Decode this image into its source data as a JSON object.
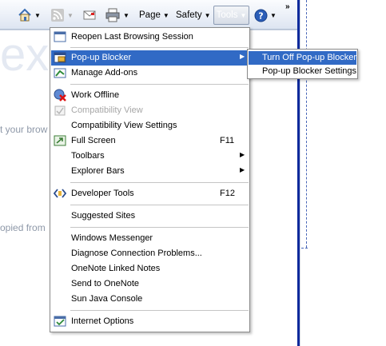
{
  "toolbar": {
    "page_label": "Page",
    "safety_label": "Safety",
    "tools_label": "Tools",
    "overflow_label": "»"
  },
  "background": {
    "heading_fragment": "ext",
    "line1": "t your brow",
    "line2": "opied from"
  },
  "menu": {
    "items": [
      {
        "label": "Reopen Last Browsing Session",
        "icon": "reopen-session-icon"
      },
      {
        "label": "Pop-up Blocker",
        "icon": "popup-blocker-icon",
        "submenu": true,
        "highlighted": true
      },
      {
        "label": "Manage Add-ons",
        "icon": "manage-addons-icon"
      },
      {
        "label": "Work Offline",
        "icon": "work-offline-icon"
      },
      {
        "label": "Compatibility View",
        "icon": "compatibility-view-icon",
        "disabled": true
      },
      {
        "label": "Compatibility View Settings"
      },
      {
        "label": "Full Screen",
        "icon": "full-screen-icon",
        "shortcut": "F11"
      },
      {
        "label": "Toolbars",
        "submenu": true
      },
      {
        "label": "Explorer Bars",
        "submenu": true
      },
      {
        "label": "Developer Tools",
        "icon": "developer-tools-icon",
        "shortcut": "F12"
      },
      {
        "label": "Suggested Sites"
      },
      {
        "label": "Windows Messenger"
      },
      {
        "label": "Diagnose Connection Problems..."
      },
      {
        "label": "OneNote Linked Notes"
      },
      {
        "label": "Send to OneNote"
      },
      {
        "label": "Sun Java Console"
      },
      {
        "label": "Internet Options",
        "icon": "internet-options-icon"
      }
    ],
    "submenu_arrow": "▶"
  },
  "popup_submenu": {
    "items": [
      {
        "label": "Turn Off Pop-up Blocker",
        "highlighted": true
      },
      {
        "label": "Pop-up Blocker Settings"
      }
    ]
  },
  "colors": {
    "highlight": "#316ac5",
    "side_bar": "#0c2a9c"
  }
}
